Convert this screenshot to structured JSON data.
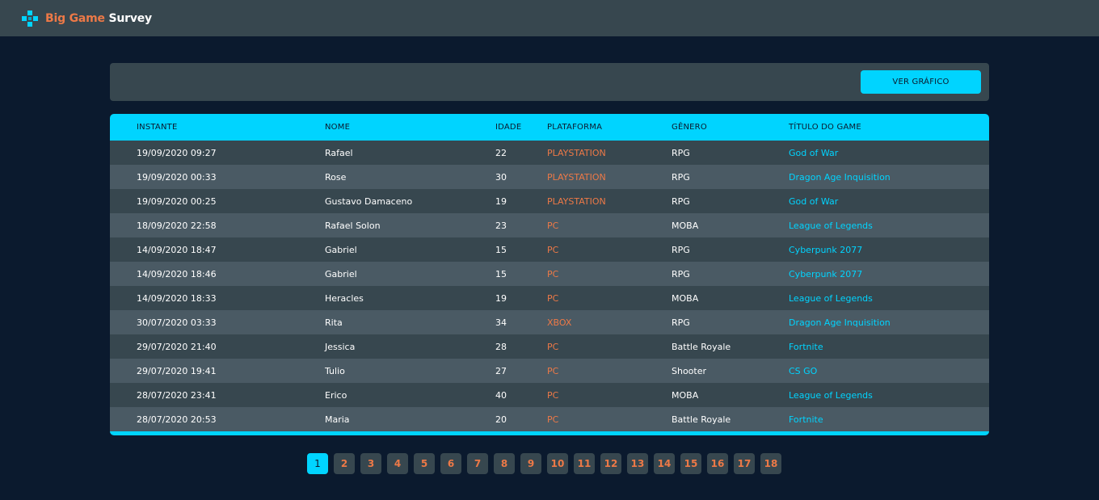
{
  "navbar": {
    "brand": "Big Game",
    "brand_rest": " Survey"
  },
  "toolbar": {
    "chart_button_label": "VER GRÁFICO"
  },
  "table": {
    "headers": [
      "INSTANTE",
      "NOME",
      "IDADE",
      "PLATAFORMA",
      "GÊNERO",
      "TÍTULO DO GAME"
    ],
    "rows": [
      [
        "19/09/2020 09:27",
        "Rafael",
        "22",
        "PLAYSTATION",
        "RPG",
        "God of War"
      ],
      [
        "19/09/2020 00:33",
        "Rose",
        "30",
        "PLAYSTATION",
        "RPG",
        "Dragon Age Inquisition"
      ],
      [
        "19/09/2020 00:25",
        "Gustavo Damaceno",
        "19",
        "PLAYSTATION",
        "RPG",
        "God of War"
      ],
      [
        "18/09/2020 22:58",
        "Rafael Solon",
        "23",
        "PC",
        "MOBA",
        "League of Legends"
      ],
      [
        "14/09/2020 18:47",
        "Gabriel",
        "15",
        "PC",
        "RPG",
        "Cyberpunk 2077"
      ],
      [
        "14/09/2020 18:46",
        "Gabriel",
        "15",
        "PC",
        "RPG",
        "Cyberpunk 2077"
      ],
      [
        "14/09/2020 18:33",
        "Heracles",
        "19",
        "PC",
        "MOBA",
        "League of Legends"
      ],
      [
        "30/07/2020 03:33",
        "Rita",
        "34",
        "XBOX",
        "RPG",
        "Dragon Age Inquisition"
      ],
      [
        "29/07/2020 21:40",
        "Jessica",
        "28",
        "PC",
        "Battle Royale",
        "Fortnite"
      ],
      [
        "29/07/2020 19:41",
        "Tulio",
        "27",
        "PC",
        "Shooter",
        "CS GO"
      ],
      [
        "28/07/2020 23:41",
        "Erico",
        "40",
        "PC",
        "MOBA",
        "League of Legends"
      ],
      [
        "28/07/2020 20:53",
        "Maria",
        "20",
        "PC",
        "Battle Royale",
        "Fortnite"
      ]
    ]
  },
  "pagination": {
    "pages": [
      "1",
      "2",
      "3",
      "4",
      "5",
      "6",
      "7",
      "8",
      "9",
      "10",
      "11",
      "12",
      "13",
      "14",
      "15",
      "16",
      "17",
      "18"
    ],
    "active": "1"
  },
  "colors": {
    "accent": "#00d4ff",
    "orange": "#ed7947",
    "background": "#0b1a2e",
    "panel": "#37474f"
  },
  "icons": {
    "logo": "gamepad-icon"
  }
}
